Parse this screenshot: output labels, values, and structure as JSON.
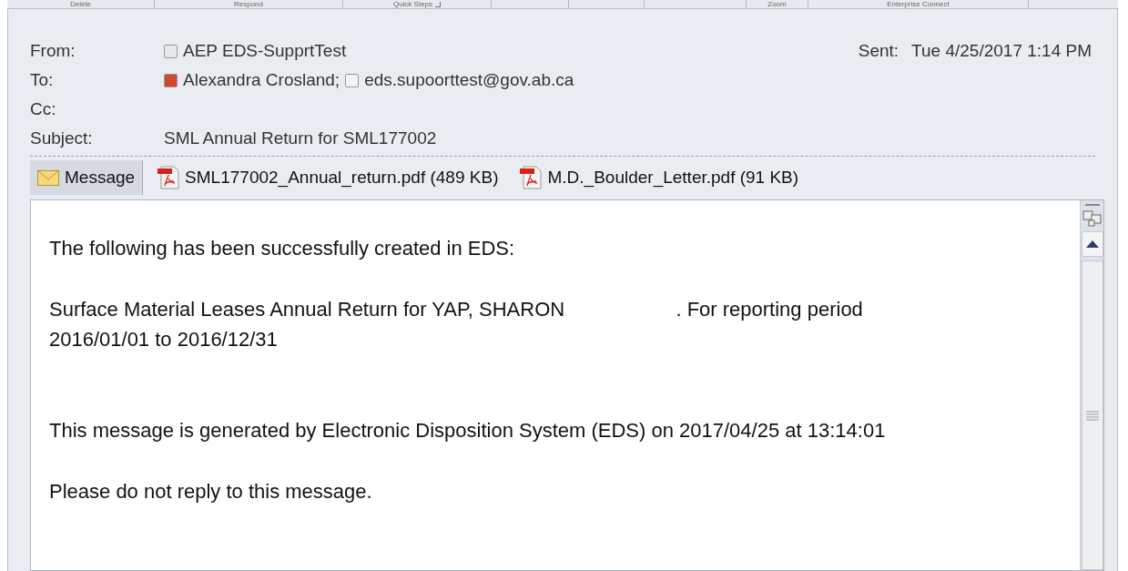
{
  "ribbon_groups": [
    {
      "kind": "labeled",
      "label": "Delete"
    },
    {
      "kind": "labeled",
      "label": "Respond"
    },
    {
      "kind": "launcher",
      "label": "Quick Steps"
    },
    {
      "kind": "unlabeled"
    },
    {
      "kind": "unlabeled"
    },
    {
      "kind": "unlabeled"
    },
    {
      "kind": "labeled",
      "label": "Zoom"
    },
    {
      "kind": "labeled",
      "label": "Enterprise Connect"
    }
  ],
  "header": {
    "from_label": "From:",
    "from": [
      {
        "name": "AEP EDS-SupprtTest",
        "color": "#e4eaec"
      }
    ],
    "to_label": "To:",
    "to": [
      {
        "name": "Alexandra Crosland;",
        "color": "#d0482e"
      },
      {
        "name": "eds.supoorttest@gov.ab.ca",
        "color": "#f2f2f2"
      }
    ],
    "cc_label": "Cc:",
    "subject_label": "Subject:",
    "subject": "SML Annual Return for SML177002",
    "sent_label": "Sent:",
    "sent": "Tue 4/25/2017 1:14 PM"
  },
  "attachments": [
    {
      "kind": "message",
      "label": "Message",
      "selected": true
    },
    {
      "kind": "pdf",
      "label": "SML177002_Annual_return.pdf (489 KB)",
      "selected": false
    },
    {
      "kind": "pdf",
      "label": "M.D._Boulder_Letter.pdf (91 KB)",
      "selected": false
    }
  ],
  "body": [
    "The following has been successfully created in EDS:",
    "Surface Material Leases Annual Return for YAP, SHARON                    . For reporting period 2016/01/01 to 2016/12/31",
    "This message is generated by Electronic Disposition System (EDS) on 2017/04/25 at 13:14:01",
    "Please do not reply to this message."
  ]
}
